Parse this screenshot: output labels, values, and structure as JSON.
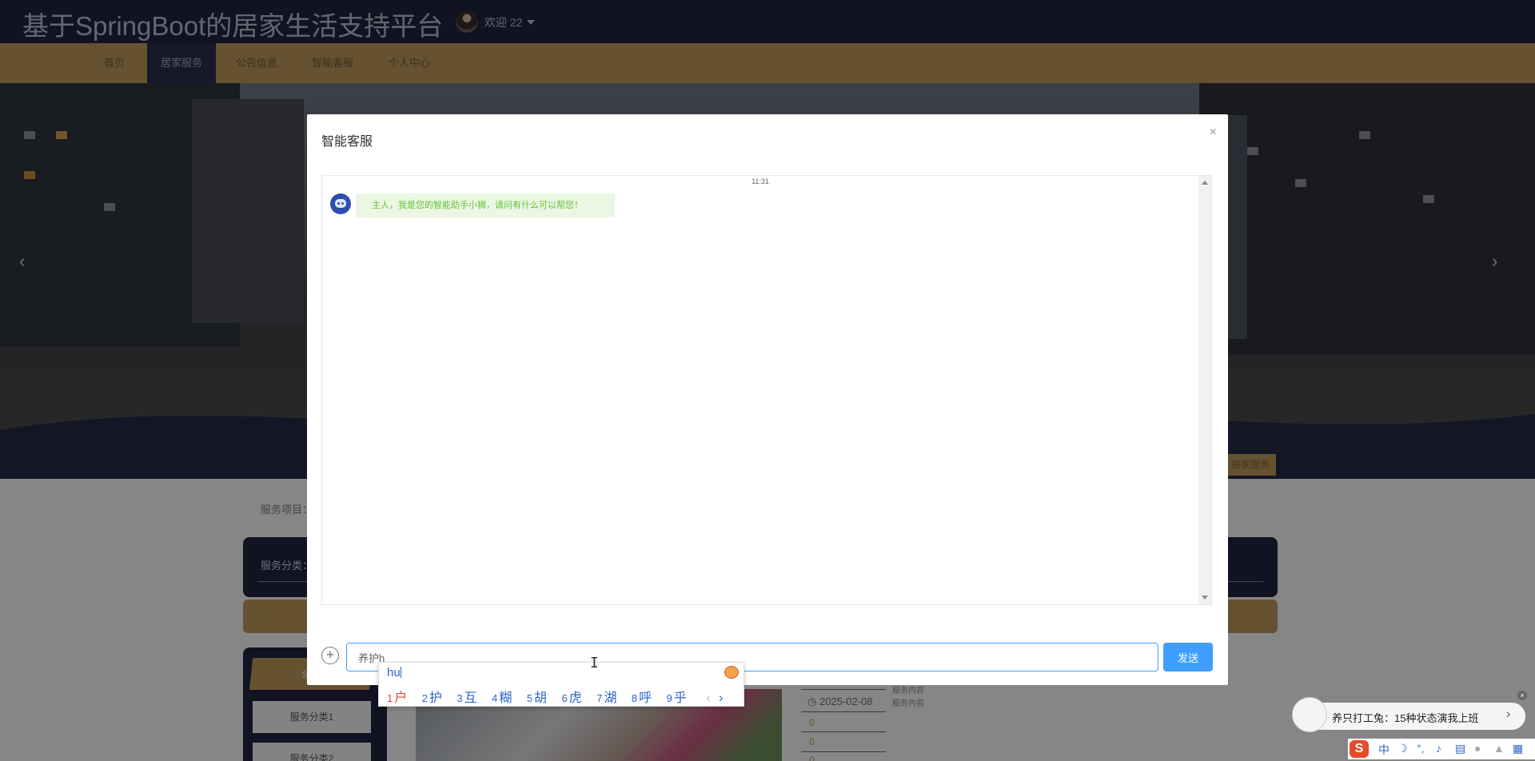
{
  "header": {
    "site_title": "基于SpringBoot的居家生活支持平台",
    "welcome": "欢迎 22"
  },
  "nav": {
    "items": [
      {
        "label": "首页"
      },
      {
        "label": "居家服务"
      },
      {
        "label": "公告信息"
      },
      {
        "label": "智能客服"
      },
      {
        "label": "个人中心"
      }
    ],
    "active_index": 1
  },
  "banner": {
    "prev": "‹",
    "next": "›"
  },
  "strip_tag": "居家服务",
  "page": {
    "crumb": "服务项目：",
    "category_label": "服务分类：",
    "side_tabs": [
      "全部",
      "服务分类1",
      "服务分类2"
    ],
    "card": {
      "date": "2025-02-08",
      "small_lines": [
        "服务内容",
        "服务内容"
      ],
      "nums": [
        "0",
        "0",
        "0"
      ]
    }
  },
  "modal": {
    "title": "智能客服",
    "close": "×",
    "chat": {
      "time": "11:31",
      "bot_message": "主人，我是您的智能助手小狮，请问有什么可以帮您！"
    },
    "input_value": "养护h",
    "send_label": "发送"
  },
  "ime": {
    "composition": "hu",
    "candidates": [
      {
        "n": "1",
        "c": "户"
      },
      {
        "n": "2",
        "c": "护"
      },
      {
        "n": "3",
        "c": "互"
      },
      {
        "n": "4",
        "c": "糊"
      },
      {
        "n": "5",
        "c": "胡"
      },
      {
        "n": "6",
        "c": "虎"
      },
      {
        "n": "7",
        "c": "湖"
      },
      {
        "n": "8",
        "c": "呼"
      },
      {
        "n": "9",
        "c": "乎"
      }
    ],
    "prev": "‹",
    "next": "›"
  },
  "notice": {
    "text": "养只打工兔：15种状态演我上班",
    "arrow": "›",
    "close": "×"
  },
  "ime_toolbar": {
    "logo": "S",
    "lang": "中",
    "icons": [
      "moon-icon",
      "punctuation-icon",
      "microphone-icon",
      "keyboard-icon",
      "user-icon",
      "shirt-icon",
      "grid-icon"
    ]
  },
  "colors": {
    "header_bg": "#1f2440",
    "nav_bg": "#b99659",
    "primary": "#409eff",
    "bot_text": "#67c23a"
  }
}
